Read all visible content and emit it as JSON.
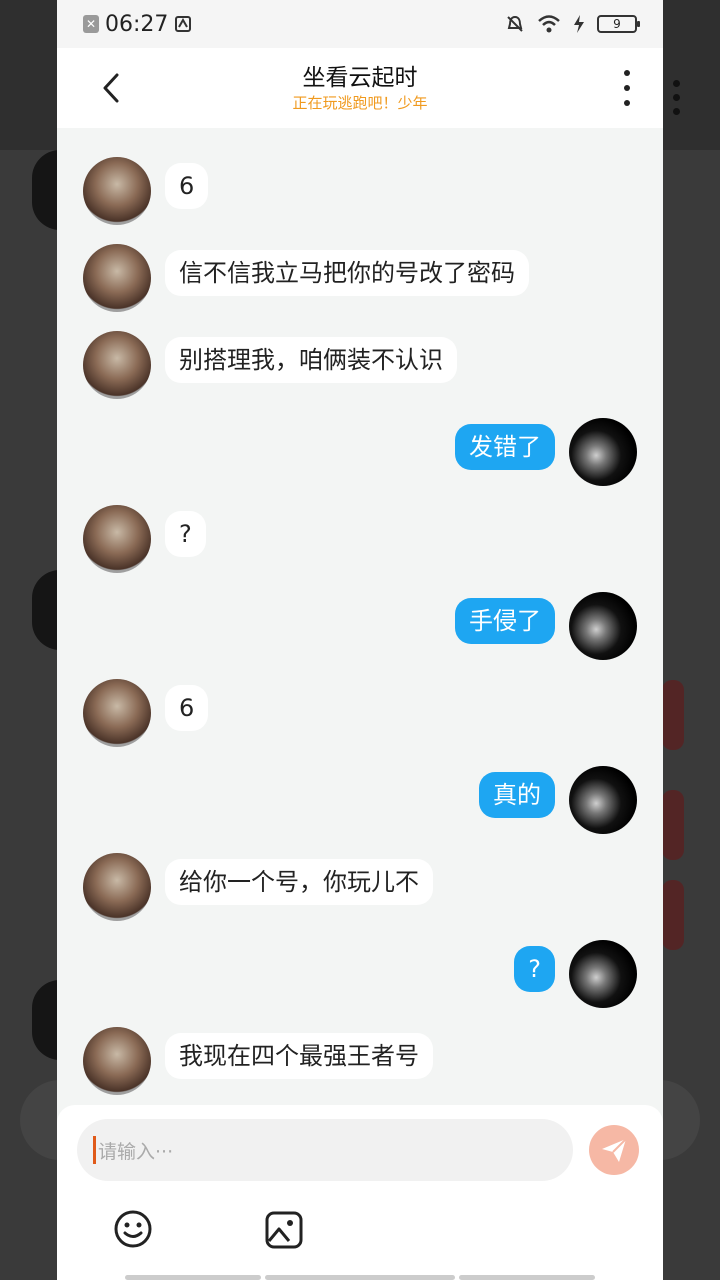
{
  "statusbar": {
    "time": "06:27",
    "battery": "9"
  },
  "header": {
    "title": "坐看云起时",
    "subtitle": "正在玩逃跑吧！少年"
  },
  "messages": [
    {
      "side": "in",
      "text": "6"
    },
    {
      "side": "in",
      "text": "信不信我立马把你的号改了密码"
    },
    {
      "side": "in",
      "text": "别搭理我，咱俩装不认识"
    },
    {
      "side": "out",
      "text": "发错了"
    },
    {
      "side": "in",
      "text": "?"
    },
    {
      "side": "out",
      "text": "手侵了"
    },
    {
      "side": "in",
      "text": "6"
    },
    {
      "side": "out",
      "text": "真的"
    },
    {
      "side": "in",
      "text": "给你一个号，你玩儿不"
    },
    {
      "side": "out",
      "text": "?"
    },
    {
      "side": "in",
      "text": "我现在四个最强王者号"
    }
  ],
  "input": {
    "placeholder": "请输入···"
  },
  "icons": {
    "back": "chevron-left-icon",
    "more": "more-vertical-icon",
    "send": "send-icon",
    "emoji": "emoji-icon",
    "image": "image-icon"
  },
  "colors": {
    "outgoing_bubble": "#1ea6f2",
    "subtitle": "#f09a1f",
    "send_button": "#f6b8a5"
  }
}
